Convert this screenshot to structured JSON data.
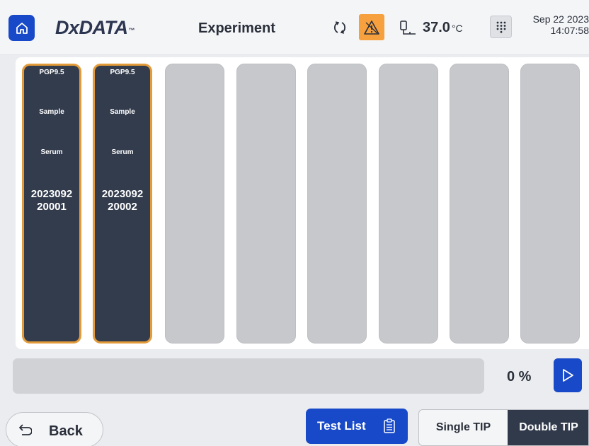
{
  "header": {
    "logo": "DxDATA",
    "logo_tm": "™",
    "title": "Experiment",
    "temperature_value": "37.0",
    "temperature_unit": "°C",
    "date": "Sep 22 2023",
    "time": "14:07:58",
    "icons": [
      "home-icon",
      "sync-icon",
      "warning-icon",
      "thermometer-icon",
      "keypad-icon"
    ],
    "alarm_color": "#f7a13e"
  },
  "slots": [
    {
      "status": "filled",
      "item": "PGP9.5",
      "type": "Sample",
      "sample": "Serum",
      "id_line1": "2023092",
      "id_line2": "20001"
    },
    {
      "status": "filled",
      "item": "PGP9.5",
      "type": "Sample",
      "sample": "Serum",
      "id_line1": "2023092",
      "id_line2": "20002"
    },
    {
      "status": "empty"
    },
    {
      "status": "empty"
    },
    {
      "status": "empty"
    },
    {
      "status": "empty"
    },
    {
      "status": "empty"
    },
    {
      "status": "empty"
    }
  ],
  "progress": {
    "value_percent": 0,
    "label": "0 %"
  },
  "footer": {
    "back_label": "Back",
    "test_list_label": "Test List",
    "tip_modes": [
      "Single TIP",
      "Double TIP"
    ],
    "selected_tip_mode": "Double TIP"
  },
  "colors": {
    "accent": "#1849c8",
    "slot_filled": "#333c4d",
    "slot_border": "#e39b3a",
    "slot_empty": "#c7c8cb",
    "selected_segment": "#313a4b"
  }
}
